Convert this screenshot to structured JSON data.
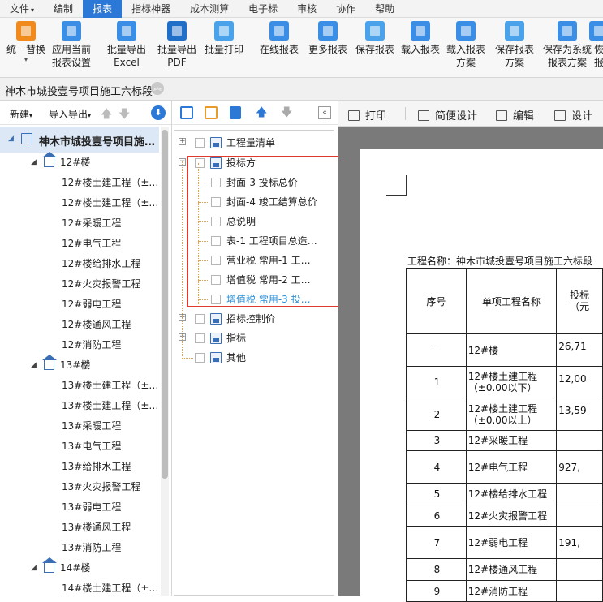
{
  "menubar": {
    "items": [
      {
        "label": "文件",
        "dropdown": true
      },
      {
        "label": "编制"
      },
      {
        "label": "报表",
        "active": true
      },
      {
        "label": "指标神器"
      },
      {
        "label": "成本测算"
      },
      {
        "label": "电子标"
      },
      {
        "label": "审核"
      },
      {
        "label": "协作"
      },
      {
        "label": "帮助"
      }
    ]
  },
  "ribbon": {
    "buttons": [
      {
        "label": "统一替换",
        "dropdown": true
      },
      {
        "label": "应用当前\n报表设置"
      },
      {
        "label": "批量导出\nExcel"
      },
      {
        "label": "批量导出\nPDF"
      },
      {
        "label": "批量打印"
      },
      {
        "label": "在线报表"
      },
      {
        "label": "更多报表"
      },
      {
        "label": "保存报表"
      },
      {
        "label": "载入报表"
      },
      {
        "label": "载入报表\n方案"
      },
      {
        "label": "保存报表\n方案"
      },
      {
        "label": "保存为系统\n报表方案"
      },
      {
        "label": "恢\n报"
      }
    ]
  },
  "project": {
    "title": "神木市城投壹号项目施工六标段"
  },
  "left_toolbar": {
    "new_label": "新建",
    "io_label": "导入导出"
  },
  "left_tree": {
    "root": "神木市城投壹号项目施…",
    "groups": [
      {
        "name": "12#楼",
        "items": [
          "12#楼土建工程（±…",
          "12#楼土建工程（±…",
          "12#采暖工程",
          "12#电气工程",
          "12#楼给排水工程",
          "12#火灾报警工程",
          "12#弱电工程",
          "12#楼通风工程",
          "12#消防工程"
        ]
      },
      {
        "name": "13#楼",
        "items": [
          "13#楼土建工程（±…",
          "13#楼土建工程（±…",
          "13#采暖工程",
          "13#电气工程",
          "13#给排水工程",
          "13#火灾报警工程",
          "13#弱电工程",
          "13#楼通风工程",
          "13#消防工程"
        ]
      },
      {
        "name": "14#楼",
        "items": [
          "14#楼土建工程（±…"
        ]
      }
    ]
  },
  "report_tree": {
    "nodes": [
      {
        "label": "工程量清单",
        "level": 0,
        "expander": "+"
      },
      {
        "label": "投标方",
        "level": 0,
        "expander": "-"
      },
      {
        "label": "封面-3 投标总价",
        "level": 1
      },
      {
        "label": "封面-4 竣工结算总价",
        "level": 1
      },
      {
        "label": "总说明",
        "level": 1
      },
      {
        "label": "表-1 工程项目总造…",
        "level": 1
      },
      {
        "label": "营业税 常用-1 工…",
        "level": 1
      },
      {
        "label": "增值税 常用-2 工…",
        "level": 1
      },
      {
        "label": "增值税 常用-3 投…",
        "level": 1,
        "selected": true
      },
      {
        "label": "招标控制价",
        "level": 0,
        "expander": "+"
      },
      {
        "label": "指标",
        "level": 0,
        "expander": "+"
      },
      {
        "label": "其他",
        "level": 0
      }
    ]
  },
  "preview_toolbar": {
    "print": "打印",
    "simple_design": "简便设计",
    "edit": "编辑",
    "design": "设计"
  },
  "preview": {
    "project_name": "工程名称：神木市城投壹号项目施工六标段",
    "headers": [
      "序号",
      "单项工程名称",
      "投标\n（元"
    ],
    "rows": [
      {
        "no": "一",
        "name": "12#楼",
        "amount": "26,71"
      },
      {
        "no": "1",
        "name": "12#楼土建工程（±0.00以下）",
        "amount": "12,00"
      },
      {
        "no": "2",
        "name": "12#楼土建工程（±0.00以上）",
        "amount": "13,59"
      },
      {
        "no": "3",
        "name": "12#采暖工程",
        "amount": ""
      },
      {
        "no": "4",
        "name": "12#电气工程",
        "amount": "927,"
      },
      {
        "no": "5",
        "name": "12#楼给排水工程",
        "amount": ""
      },
      {
        "no": "6",
        "name": "12#火灾报警工程",
        "amount": ""
      },
      {
        "no": "7",
        "name": "12#弱电工程",
        "amount": "191,"
      },
      {
        "no": "8",
        "name": "12#楼通风工程",
        "amount": ""
      },
      {
        "no": "9",
        "name": "12#消防工程",
        "amount": ""
      }
    ]
  },
  "colors": {
    "accent": "#2b78d6",
    "highlight_box": "#e03a2f",
    "selected_text": "#2b90d9"
  }
}
